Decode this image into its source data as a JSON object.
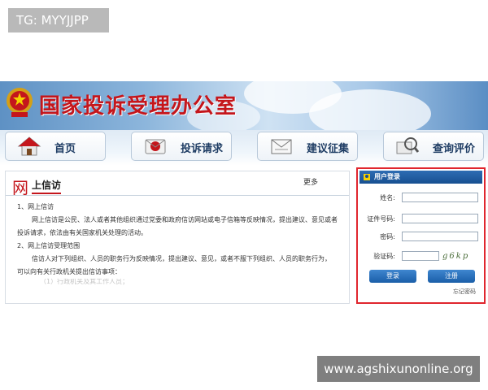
{
  "tg_badge": "TG: MYYJJPP",
  "header": {
    "title": "国家投诉受理办公室",
    "brand_color": "#c4161c"
  },
  "nav": {
    "items": [
      {
        "label": "首页",
        "icon": "house-icon"
      },
      {
        "label": "投诉请求",
        "icon": "mail-icon"
      },
      {
        "label": "建议征集",
        "icon": "envelope-icon"
      },
      {
        "label": "查询评价",
        "icon": "magnifier-icon"
      }
    ]
  },
  "content": {
    "big_char": "网",
    "title": "上信访",
    "more": "更多",
    "lines": [
      "1、网上信访",
      "网上信访是公民、法人或者其他组织通过党委和政府信访网站或电子信箱等反映情况，提出建议、意见或者",
      "投诉请求，依法由有关国家机关处理的活动。",
      "2、网上信访受理范围",
      "信访人对下列组织、人员的职务行为反映情况，提出建议、意见，或者不服下列组织、人员的职务行为，",
      "可以向有关行政机关提出信访事项：",
      "（1）行政机关及其工作人员；"
    ]
  },
  "login": {
    "title": "用户登录",
    "fields": [
      {
        "label": "姓名:",
        "value": ""
      },
      {
        "label": "证件号码:",
        "value": ""
      },
      {
        "label": "密码:",
        "value": ""
      },
      {
        "label": "验证码:",
        "value": ""
      }
    ],
    "captcha": "g6kp",
    "login_button": "登录",
    "register_button": "注册",
    "forgot": "忘记密码",
    "accent_color": "#e0262e"
  },
  "watermark": "www.agshixunonline.org"
}
